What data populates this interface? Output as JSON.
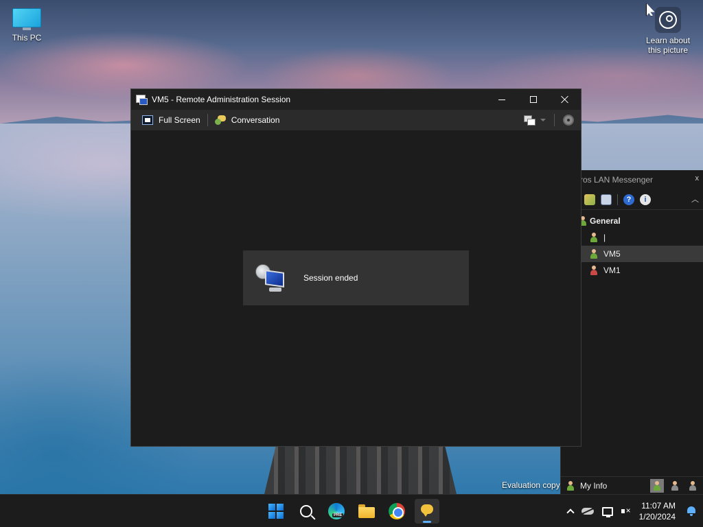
{
  "desktop": {
    "icons": [
      {
        "label": "This PC"
      },
      {
        "label": "Learn about this picture"
      }
    ],
    "watermark": "Evaluation copy"
  },
  "session_window": {
    "title": "VM5 - Remote Administration Session",
    "toolbar": {
      "full_screen": "Full Screen",
      "conversation": "Conversation"
    },
    "status_message": "Session ended"
  },
  "messenger": {
    "title": "ros LAN Messenger",
    "close": "x",
    "group": "General",
    "users": [
      {
        "name": "|",
        "status": "green"
      },
      {
        "name": "VM5",
        "status": "green",
        "selected": true
      },
      {
        "name": "VM1",
        "status": "red"
      }
    ],
    "my_info": "My Info"
  },
  "taskbar": {
    "apps": [
      "start-icon",
      "search-icon",
      "edge-icon",
      "file-explorer-icon",
      "chrome-icon",
      "lan-messenger-icon"
    ],
    "pre_badge": "PRE",
    "clock": {
      "time": "11:07 AM",
      "date": "1/20/2024"
    }
  },
  "colors": {
    "window_bg": "#1c1c1c",
    "toolbar_bg": "#2b2b2b",
    "panel_bg": "#333333",
    "taskbar_bg": "#1c1c1c",
    "accent": "#5cb0ff"
  }
}
